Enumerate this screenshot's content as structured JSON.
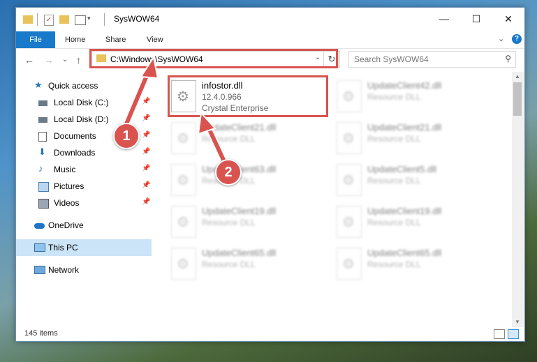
{
  "window": {
    "title": "SysWOW64",
    "controls": {
      "minimize": "—",
      "maximize": "☐",
      "close": "✕"
    }
  },
  "ribbon": {
    "tabs": [
      "File",
      "Home",
      "Share",
      "View"
    ],
    "expand_icon": "chevron-down-icon",
    "help_label": "?"
  },
  "address": {
    "path": "C:\\Windows\\SysWOW64",
    "search_placeholder": "Search SysWOW64"
  },
  "nav": {
    "items": [
      {
        "label": "Quick access",
        "icon": "star-icon",
        "pinned": false
      },
      {
        "label": "Local Disk (C:)",
        "icon": "drive-icon",
        "pinned": true
      },
      {
        "label": "Local Disk (D:)",
        "icon": "drive-icon",
        "pinned": true
      },
      {
        "label": "Documents",
        "icon": "documents-icon",
        "pinned": true
      },
      {
        "label": "Downloads",
        "icon": "downloads-icon",
        "pinned": true
      },
      {
        "label": "Music",
        "icon": "music-icon",
        "pinned": true
      },
      {
        "label": "Pictures",
        "icon": "pictures-icon",
        "pinned": true
      },
      {
        "label": "Videos",
        "icon": "videos-icon",
        "pinned": true
      },
      {
        "label": "OneDrive",
        "icon": "onedrive-icon",
        "pinned": false
      },
      {
        "label": "This PC",
        "icon": "pc-icon",
        "pinned": false
      },
      {
        "label": "Network",
        "icon": "network-icon",
        "pinned": false
      }
    ]
  },
  "files": {
    "highlighted": {
      "name": "infostor.dll",
      "version": "12.4.0.966",
      "company": "Crystal Enterprise"
    },
    "others": [
      {
        "name": "UpdateClient42.dll",
        "type": "Resource DLL"
      },
      {
        "name": "UpdateClient21.dll",
        "type": "Resource DLL"
      },
      {
        "name": "UpdateClient21.dll",
        "type": "Resource DLL"
      },
      {
        "name": "UpdateClient63.dll",
        "type": "Resource DLL"
      },
      {
        "name": "UpdateClient5.dll",
        "type": "Resource DLL"
      },
      {
        "name": "UpdateClient19.dll",
        "type": "Resource DLL"
      },
      {
        "name": "UpdateClient19.dll",
        "type": "Resource DLL"
      },
      {
        "name": "UpdateClient65.dll",
        "type": "Resource DLL"
      },
      {
        "name": "UpdateClient65.dll",
        "type": "Resource DLL"
      }
    ]
  },
  "status": {
    "count": "145 items"
  },
  "annotations": {
    "step1": "1",
    "step2": "2",
    "color": "#d9534f"
  }
}
